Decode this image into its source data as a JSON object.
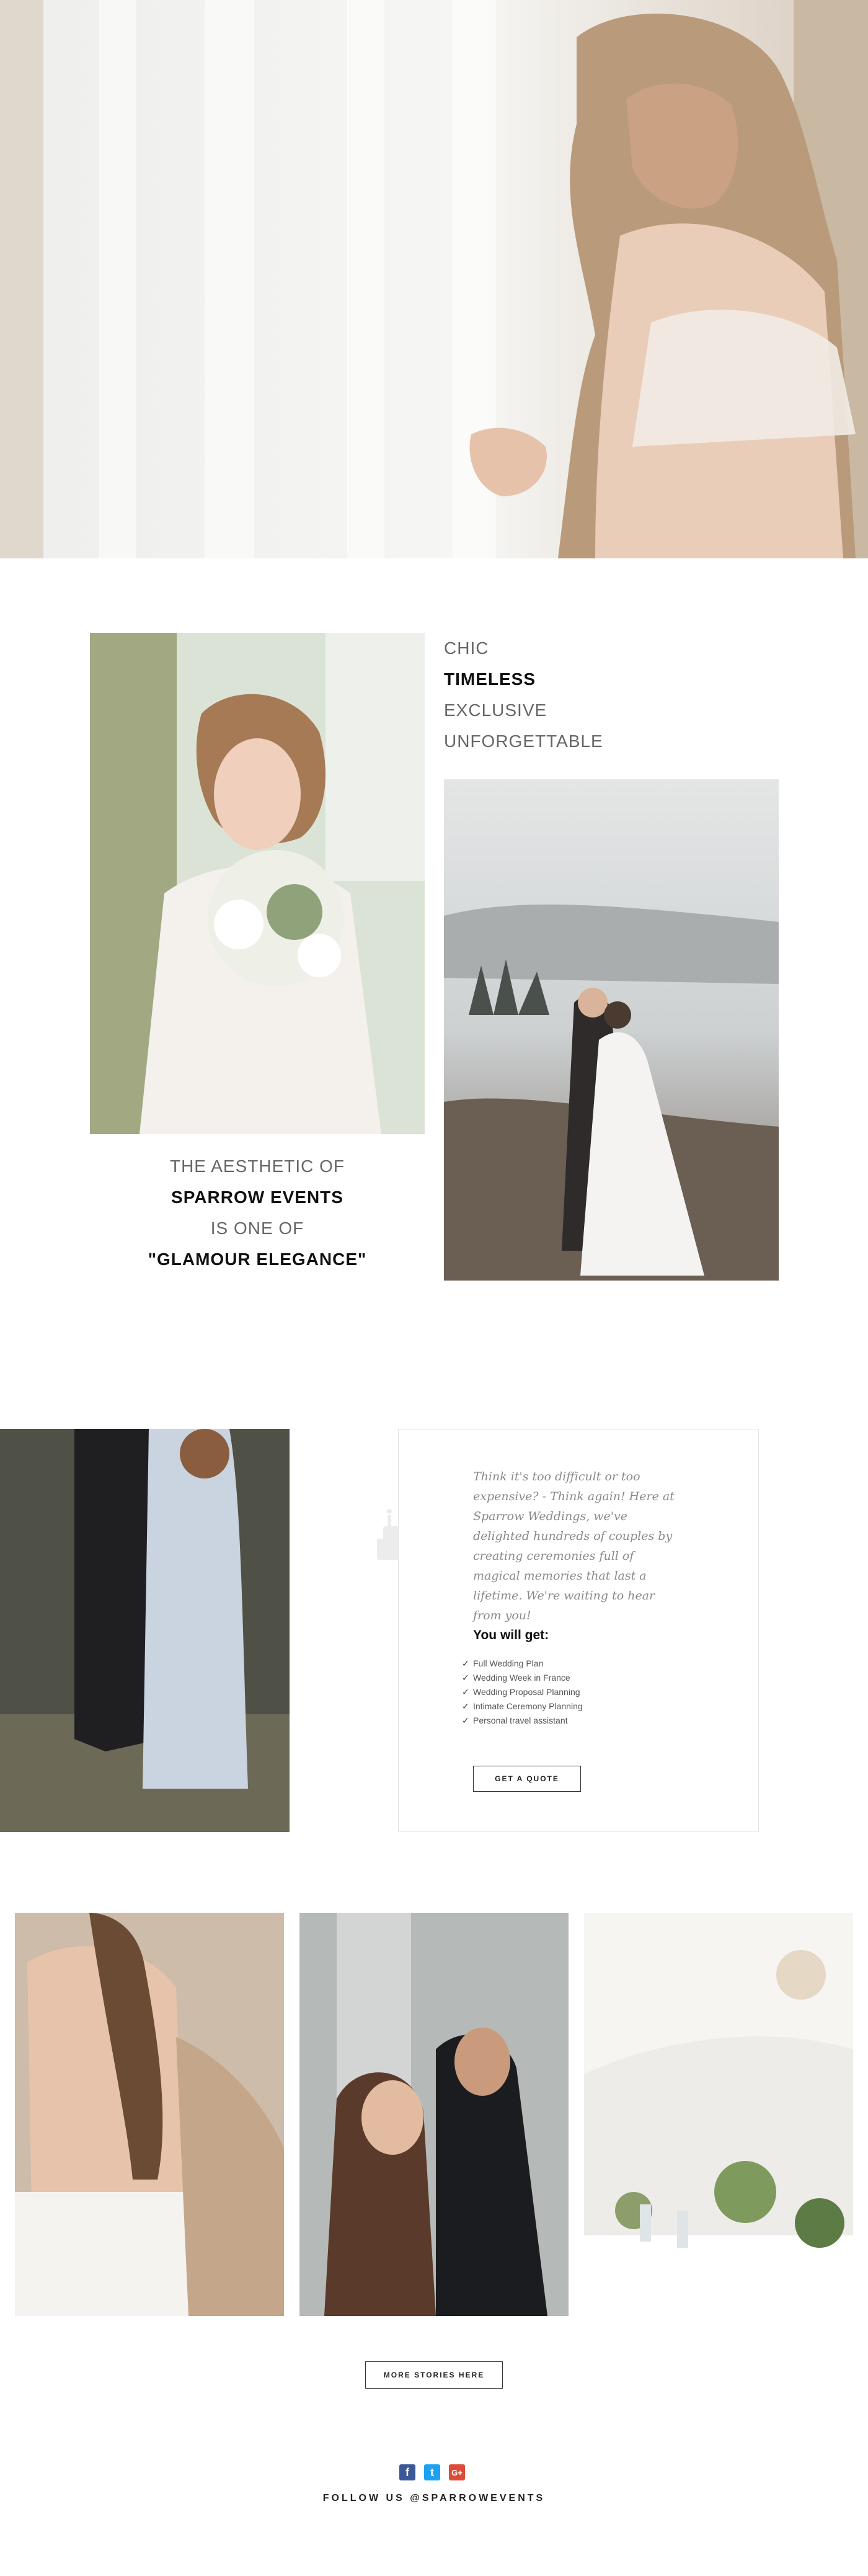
{
  "hero": {
    "alt": "bride at window"
  },
  "intro": {
    "words": [
      "CHIC",
      "TIMELESS",
      "EXCLUSIVE",
      "UNFORGETTABLE"
    ],
    "aesthetic": [
      "THE AESTHETIC OF",
      "SPARROW EVENTS",
      "IS ONE OF",
      "\"GLAMOUR ELEGANCE\""
    ]
  },
  "quote": {
    "text": "Think it's too difficult or too expensive? - Think again! Here at Sparrow Weddings, we've delighted hundreds of couples by creating ceremonies full of magical memories that last a lifetime. We're waiting to hear from you!",
    "you_will_get": "You will get:",
    "benefits": [
      "Full Wedding Plan",
      "Wedding Week in France",
      "Wedding Proposal Planning",
      "Intimate Ceremony Planning",
      "Personal travel assistant"
    ],
    "cta": "GET A QUOTE"
  },
  "stories": {
    "cta": "MORE STORIES HERE"
  },
  "footer": {
    "social": [
      {
        "icon": "facebook-icon",
        "glyph": "f",
        "color": "#3b5998"
      },
      {
        "icon": "twitter-icon",
        "glyph": "t",
        "color": "#1da1f2"
      },
      {
        "icon": "google-plus-icon",
        "glyph": "G+",
        "color": "#dd4b39"
      }
    ],
    "follow": "FOLLOW US @SPARROWEVENTS"
  },
  "colors": {
    "text": "#222222",
    "muted": "#666666",
    "border": "#e4e4e4"
  }
}
